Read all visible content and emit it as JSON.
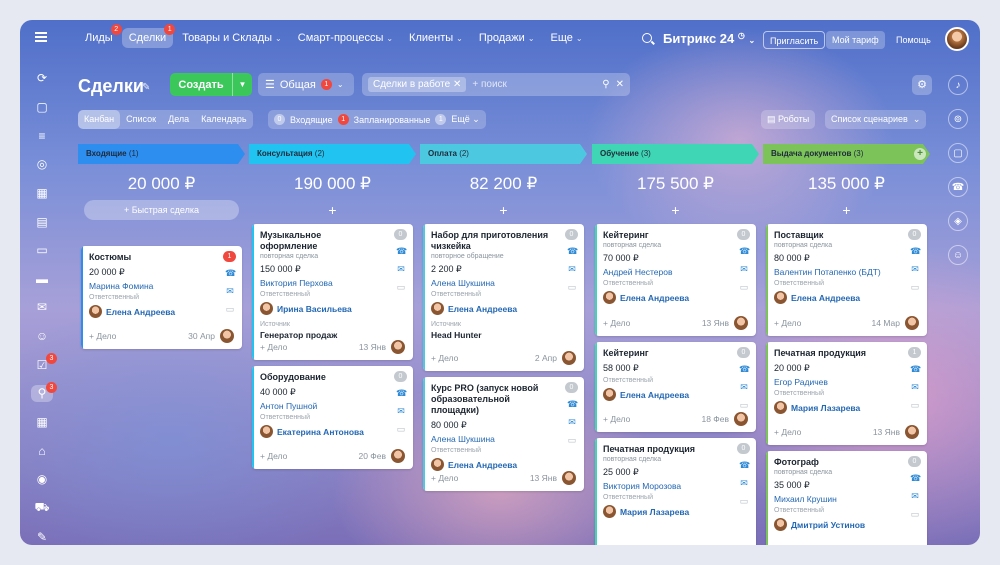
{
  "topbar": {
    "nav": [
      {
        "label": "Лиды",
        "badge": "2",
        "active": false,
        "chev": ""
      },
      {
        "label": "Сделки",
        "badge": "1",
        "active": true,
        "chev": ""
      },
      {
        "label": "Товары и Склады",
        "badge": "",
        "active": false,
        "chev": "⌄"
      },
      {
        "label": "Смарт-процессы",
        "badge": "",
        "active": false,
        "chev": "⌄"
      },
      {
        "label": "Клиенты",
        "badge": "",
        "active": false,
        "chev": "⌄"
      },
      {
        "label": "Продажи",
        "badge": "",
        "active": false,
        "chev": "⌄"
      },
      {
        "label": "Еще",
        "badge": "",
        "active": false,
        "chev": "⌄"
      }
    ],
    "brand": "Битрикс 24",
    "invite": "Пригласить",
    "tariff": "Мой тариф",
    "help": "Помощь"
  },
  "sidebar": [
    {
      "icon": "⟳",
      "name": "pulse-icon",
      "badge": ""
    },
    {
      "icon": "▢",
      "name": "chat-icon",
      "badge": ""
    },
    {
      "icon": "≡",
      "name": "feed-icon",
      "badge": ""
    },
    {
      "icon": "◎",
      "name": "groups-icon",
      "badge": ""
    },
    {
      "icon": "▦",
      "name": "calendar-icon",
      "badge": ""
    },
    {
      "icon": "▤",
      "name": "docs-icon",
      "badge": ""
    },
    {
      "icon": "▭",
      "name": "screen-icon",
      "badge": ""
    },
    {
      "icon": "▬",
      "name": "drive-icon",
      "badge": ""
    },
    {
      "icon": "✉",
      "name": "mail-icon",
      "badge": ""
    },
    {
      "icon": "☺",
      "name": "contacts-icon",
      "badge": ""
    },
    {
      "icon": "☑",
      "name": "tasks-icon",
      "badge": "3"
    },
    {
      "icon": "⚲",
      "name": "crm-icon",
      "badge": "3"
    },
    {
      "icon": "▦",
      "name": "booking-icon",
      "badge": ""
    },
    {
      "icon": "⌂",
      "name": "store-icon",
      "badge": ""
    },
    {
      "icon": "◉",
      "name": "marketing-icon",
      "badge": ""
    },
    {
      "icon": "⛟",
      "name": "cart-icon",
      "badge": ""
    },
    {
      "icon": "✎",
      "name": "sign-icon",
      "badge": ""
    }
  ],
  "header": {
    "title": "Сделки",
    "create": "Создать",
    "category": "Общая",
    "category_badge": "1",
    "filter_chip": "Сделки в работе",
    "search_placeholder": "+ поиск"
  },
  "views": [
    "Канбан",
    "Список",
    "Дела",
    "Календарь"
  ],
  "counters": {
    "incoming_count": "0",
    "incoming": "Входящие",
    "planned_count": "1",
    "planned": "Запланированные",
    "more_count": "1",
    "more": "Ещё"
  },
  "robots": "Роботы",
  "scenarios": "Список сценариев",
  "columns": [
    {
      "stage": "Входящие",
      "count": "(1)",
      "color": "#2d8ef0",
      "total": "20 000 ₽",
      "quick": "Быстрая сделка",
      "cards": [
        {
          "title": "Костюмы",
          "subtitle": "",
          "amount": "20 000 ₽",
          "client": "Марина Фомина",
          "resp_label": "Ответственный",
          "resp": "Елена Андреева",
          "src_label": "",
          "src": "",
          "date": "30 Апр",
          "badge": "1",
          "badge_red": true,
          "add": "+ Дело"
        }
      ]
    },
    {
      "stage": "Консультация",
      "count": "(2)",
      "color": "#21c3f0",
      "total": "190 000 ₽",
      "quick": "",
      "cards": [
        {
          "title": "Музыкальное оформление",
          "subtitle": "повторная сделка",
          "amount": "150 000 ₽",
          "client": "Виктория Перхова",
          "resp_label": "Ответственный",
          "resp": "Ирина Васильева",
          "src_label": "Источник",
          "src": "Генератор продаж",
          "date": "13 Янв",
          "badge": "0",
          "badge_red": false,
          "add": "+ Дело"
        },
        {
          "title": "Оборудование",
          "subtitle": "",
          "amount": "40 000 ₽",
          "client": "Антон Пушной",
          "resp_label": "Ответственный",
          "resp": "Екатерина Антонова",
          "src_label": "",
          "src": "",
          "date": "20 Фев",
          "badge": "0",
          "badge_red": false,
          "add": "+ Дело"
        }
      ]
    },
    {
      "stage": "Оплата",
      "count": "(2)",
      "color": "#4cc9e0",
      "total": "82 200 ₽",
      "quick": "",
      "cards": [
        {
          "title": "Набор для приготовления чизкейка",
          "subtitle": "повторное обращение",
          "amount": "2 200 ₽",
          "client": "Алена Шукшина",
          "resp_label": "Ответственный",
          "resp": "Елена Андреева",
          "src_label": "Источник",
          "src": "Head Hunter",
          "date": "2 Апр",
          "badge": "0",
          "badge_red": false,
          "add": "+ Дело"
        },
        {
          "title": "Курс PRO (запуск новой образовательной площадки)",
          "subtitle": "",
          "amount": "80 000 ₽",
          "client": "Алена Шукшина",
          "resp_label": "Ответственный",
          "resp": "Елена Андреева",
          "src_label": "",
          "src": "",
          "date": "13 Янв",
          "badge": "0",
          "badge_red": false,
          "add": "+ Дело"
        }
      ]
    },
    {
      "stage": "Обучение",
      "count": "(3)",
      "color": "#3fd6b5",
      "total": "175 500 ₽",
      "quick": "",
      "cards": [
        {
          "title": "Кейтеринг",
          "subtitle": "повторная сделка",
          "amount": "70 000 ₽",
          "client": "Андрей Нестеров",
          "resp_label": "Ответственный",
          "resp": "Елена Андреева",
          "src_label": "",
          "src": "",
          "date": "13 Янв",
          "badge": "0",
          "badge_red": false,
          "add": "+ Дело"
        },
        {
          "title": "Кейтеринг",
          "subtitle": "",
          "amount": "58 000 ₽",
          "client": "",
          "resp_label": "Ответственный",
          "resp": "Елена Андреева",
          "src_label": "",
          "src": "",
          "date": "18 Фев",
          "badge": "0",
          "badge_red": false,
          "add": "+ Дело"
        },
        {
          "title": "Печатная продукция",
          "subtitle": "повторная сделка",
          "amount": "25 000 ₽",
          "client": "Виктория Морозова",
          "resp_label": "Ответственный",
          "resp": "Мария Лазарева",
          "src_label": "",
          "src": "",
          "date": "",
          "badge": "0",
          "badge_red": false,
          "add": ""
        }
      ]
    },
    {
      "stage": "Выдача документов",
      "count": "(3)",
      "color": "#7cc35a",
      "total": "135 000 ₽",
      "quick": "",
      "cards": [
        {
          "title": "Поставщик",
          "subtitle": "повторная сделка",
          "amount": "80 000 ₽",
          "client": "Валентин Потапенко (БДТ)",
          "resp_label": "Ответственный",
          "resp": "Елена Андреева",
          "src_label": "",
          "src": "",
          "date": "14 Мар",
          "badge": "0",
          "badge_red": false,
          "add": "+ Дело"
        },
        {
          "title": "Печатная продукция",
          "subtitle": "",
          "amount": "20 000 ₽",
          "client": "Егор Радичев",
          "resp_label": "Ответственный",
          "resp": "Мария Лазарева",
          "src_label": "",
          "src": "",
          "date": "13 Янв",
          "badge": "1",
          "badge_red": false,
          "add": "+ Дело"
        },
        {
          "title": "Фотограф",
          "subtitle": "повторная сделка",
          "amount": "35 000 ₽",
          "client": "Михаил Крушин",
          "resp_label": "Ответственный",
          "resp": "Дмитрий Устинов",
          "src_label": "",
          "src": "",
          "date": "",
          "badge": "0",
          "badge_red": false,
          "add": ""
        }
      ]
    }
  ]
}
